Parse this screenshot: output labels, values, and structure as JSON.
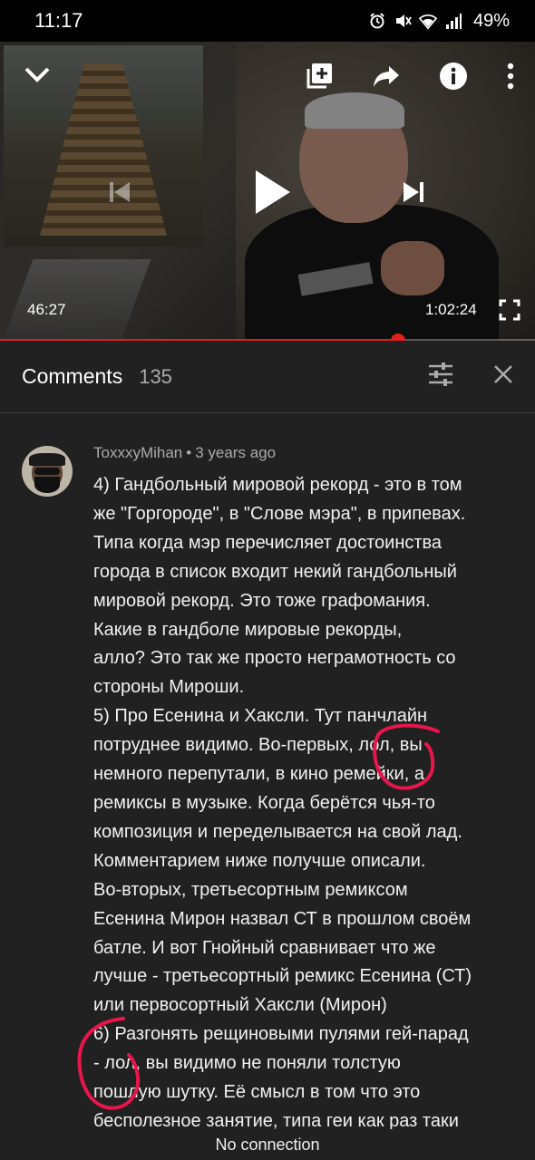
{
  "status_bar": {
    "time": "11:17",
    "battery": "49%",
    "icons": [
      "alarm-icon",
      "mute-icon",
      "wifi-icon",
      "signal-icon"
    ]
  },
  "player": {
    "current_time": "46:27",
    "duration": "1:02:24",
    "progress_fraction": 0.744,
    "colors": {
      "progress": "#e0201a"
    },
    "controls": [
      "collapse-icon",
      "add-to-playlist-icon",
      "share-icon",
      "info-icon",
      "more-icon",
      "previous-icon",
      "play-icon",
      "next-icon",
      "fullscreen-icon"
    ]
  },
  "comments_header": {
    "title": "Comments",
    "count": "135",
    "actions": [
      "sort-filter-icon",
      "close-icon"
    ]
  },
  "comment": {
    "author": "ToxxxyMihan",
    "separator": "•",
    "time": "3 years ago",
    "body": "4) Гандбольный мировой рекорд - это в том\nже \"Горгороде\", в \"Слове мэра\", в припевах.\nТипа когда мэр перечисляет достоинства\nгорода в список входит некий гандбольный\nмировой рекорд. Это тоже графомания.\nКакие в гандболе мировые рекорды,\nалло? Это так же просто неграмотность со\nстороны Мироши.\n5) Про Есенина и Хаксли. Тут панчлайн\nпотруднее видимо. Во-первых, лол, вы\nнемного перепутали, в кино ремейки, а\nремиксы в музыке. Когда берётся чья-то\nкомпозиция и переделывается на свой лад.\nКомментарием ниже получше описали.\nВо-вторых, третьесортным ремиксом\nЕсенина Мирон назвал СТ в прошлом своём\nбатле. И вот Гнойный сравнивает что же\nлучше - третьесортный ремикс Есенина (СТ)\nили первосортный Хаксли (Мирон)\n6) Разгонять рещиновыми пулями гей-парад\n- лол, вы видимо не поняли толстую\nпошлую шутку. Её смысл в том что это\nбесполезное занятие, типа геи как раз таки"
  },
  "toast": "No connection"
}
